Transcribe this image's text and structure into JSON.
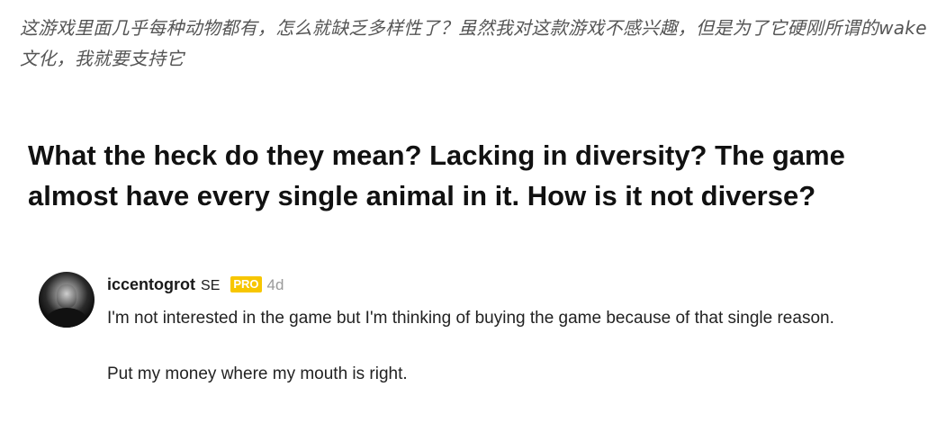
{
  "caption_cn": "这游戏里面几乎每种动物都有，怎么就缺乏多样性了？虽然我对这款游戏不感兴趣，但是为了它硬刚所谓的wake 文化，我就要支持它",
  "headline": "What the heck do they mean? Lacking in diversity? The game almost have every single animal in it. How is it not diverse?",
  "comment": {
    "avatar_icon": "user-avatar-photo",
    "username": "iccentogrot",
    "flair": "SE",
    "badge": "PRO",
    "badge_color": "#f7c600",
    "time": "4d",
    "paragraphs": [
      "I'm not interested in the game but I'm thinking of buying the game because of that single reason.",
      "Put my money where my mouth is right."
    ]
  }
}
